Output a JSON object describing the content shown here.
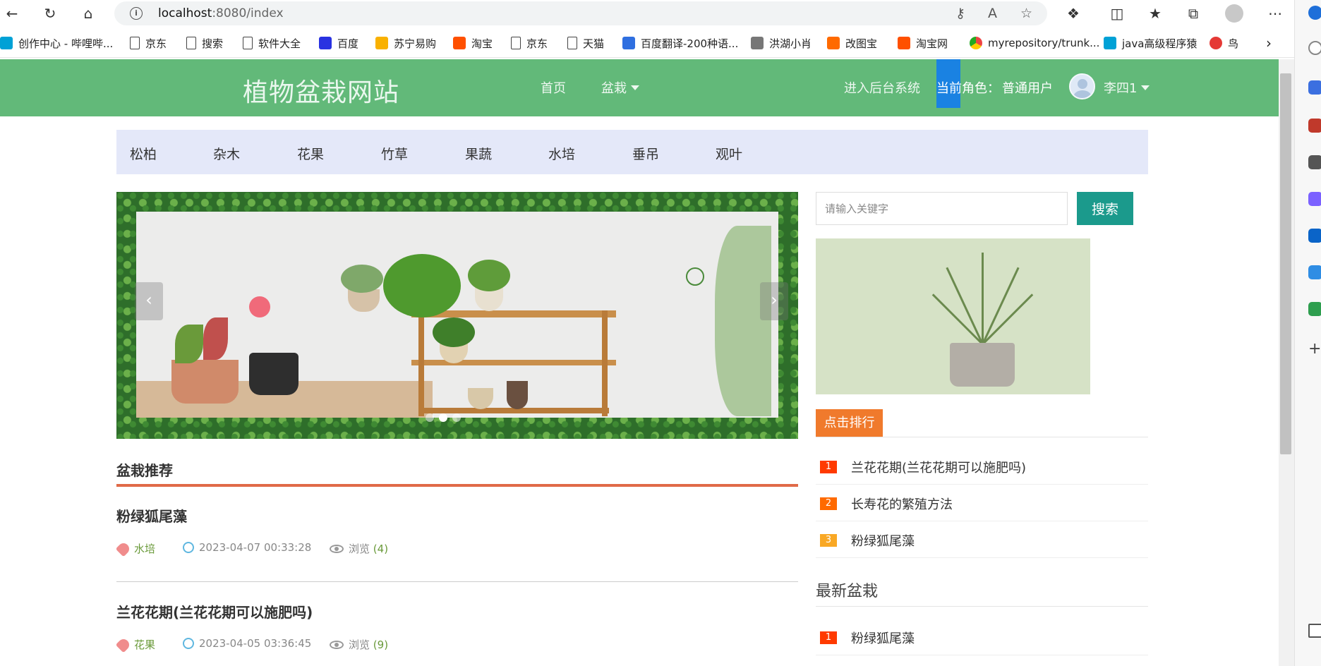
{
  "browser": {
    "url_host": "localhost",
    "url_path": ":8080/index",
    "bookmarks": [
      {
        "label": "创作中心 - 哔哩哔...",
        "icon": "bilibili-icon"
      },
      {
        "label": "京东",
        "icon": "page-icon"
      },
      {
        "label": "搜索",
        "icon": "page-icon"
      },
      {
        "label": "软件大全",
        "icon": "page-icon"
      },
      {
        "label": "百度",
        "icon": "baidu-icon"
      },
      {
        "label": "苏宁易购",
        "icon": "suning-icon"
      },
      {
        "label": "淘宝",
        "icon": "taobao-icon"
      },
      {
        "label": "京东",
        "icon": "page-icon"
      },
      {
        "label": "天猫",
        "icon": "page-icon"
      },
      {
        "label": "百度翻译-200种语...",
        "icon": "translate-icon"
      },
      {
        "label": "洪湖小肖",
        "icon": "mi-icon"
      },
      {
        "label": "改图宝",
        "icon": "image-icon"
      },
      {
        "label": "淘宝网",
        "icon": "taobao-icon"
      },
      {
        "label": "myrepository/trunk...",
        "icon": "chrome-icon"
      },
      {
        "label": "java高级程序猿",
        "icon": "bilibili-icon"
      },
      {
        "label": "鸟",
        "icon": "bird-icon"
      }
    ]
  },
  "header": {
    "logo": "植物盆栽网站",
    "nav": {
      "home": "首页",
      "bonsai": "盆栽"
    },
    "admin": "进入后台系统",
    "role_label": "当前角色：",
    "role_value": "普通用户",
    "username": "李四1",
    "colors": {
      "bg": "#62b979"
    }
  },
  "categories": [
    "松柏",
    "杂木",
    "花果",
    "竹草",
    "果蔬",
    "水培",
    "垂吊",
    "观叶"
  ],
  "search": {
    "placeholder": "请输入关键字",
    "button": "搜索"
  },
  "ranking": {
    "tab": "点击排行",
    "items": [
      {
        "rank": "1",
        "title": "兰花花期(兰花花期可以施肥吗)",
        "color": "#ff3a00"
      },
      {
        "rank": "2",
        "title": "长寿花的繁殖方法",
        "color": "#ff6a00"
      },
      {
        "rank": "3",
        "title": "粉绿狐尾藻",
        "color": "#f9a825"
      }
    ]
  },
  "latest": {
    "title": "最新盆栽",
    "items": [
      {
        "rank": "1",
        "title": "粉绿狐尾藻",
        "color": "#ff3a00"
      }
    ]
  },
  "recommend": {
    "title": "盆栽推荐",
    "posts": [
      {
        "title": "粉绿狐尾藻",
        "category": "水培",
        "date": "2023-04-07 00:33:28",
        "view_label": "浏览",
        "views": "(4)"
      },
      {
        "title": "兰花花期(兰花花期可以施肥吗)",
        "category": "花果",
        "date": "2023-04-05 03:36:45",
        "view_label": "浏览",
        "views": "(9)"
      }
    ]
  }
}
